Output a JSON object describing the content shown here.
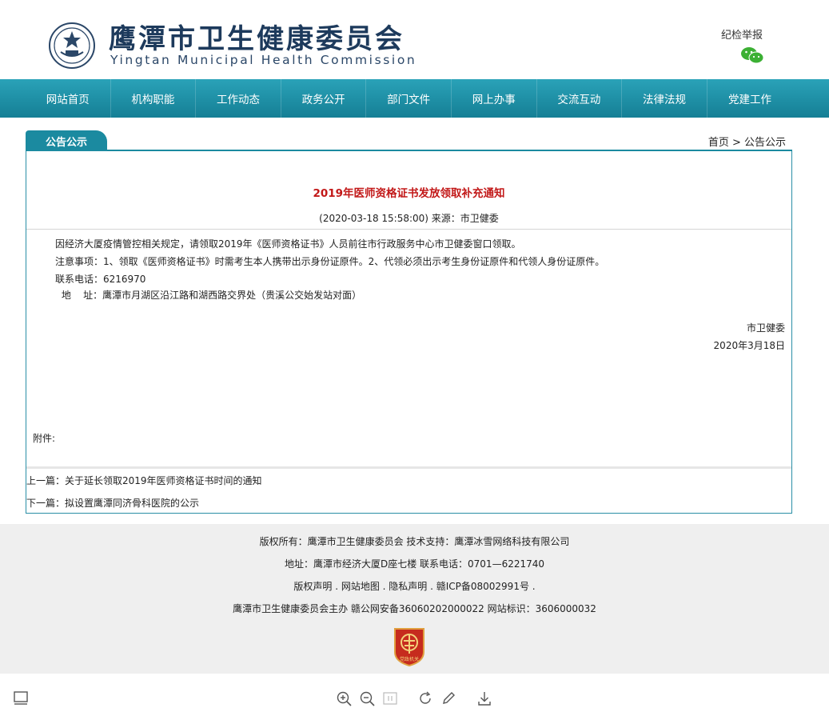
{
  "window": {
    "minimize": "–",
    "maximize": "☐",
    "close": "✕"
  },
  "header": {
    "title_cn": "鹰潭市卫生健康委员会",
    "title_en": "Yingtan Municipal Health Commission",
    "report_link": "纪检举报",
    "wechat_icon": "wechat-icon"
  },
  "nav": {
    "items": [
      "网站首页",
      "机构职能",
      "工作动态",
      "政务公开",
      "部门文件",
      "网上办事",
      "交流互动",
      "法律法规",
      "党建工作"
    ]
  },
  "section": {
    "tab": "公告公示",
    "breadcrumb": "首页 > 公告公示"
  },
  "article": {
    "title": "2019年医师资格证书发放领取补充通知",
    "meta": "(2020-03-18 15:58:00)   来源：市卫健委",
    "lines": [
      "因经济大厦疫情管控相关规定，请领取2019年《医师资格证书》人员前往市行政服务中心市卫健委窗口领取。",
      "注意事项：1、领取《医师资格证书》时需考生本人携带出示身份证原件。2、代领必须出示考生身份证原件和代领人身份证原件。",
      "联系电话：6216970",
      " 地    址：鹰潭市月湖区沿江路和湖西路交界处（贵溪公交始发站对面）"
    ],
    "sign_org": "市卫健委",
    "sign_date": "2020年3月18日",
    "attachment": "附件:",
    "prev": "上一篇：关于延长领取2019年医师资格证书时间的通知",
    "next": "下一篇：拟设置鹰潭同济骨科医院的公示"
  },
  "footer": {
    "line1": "版权所有：鹰潭市卫生健康委员会 技术支持：鹰潭冰雪网络科技有限公司",
    "line2": "地址：鹰潭市经济大厦D座七楼 联系电话：0701—6221740",
    "line3": "版权声明 . 网站地图 . 隐私声明 . 赣ICP备08002991号 .",
    "line4": "鹰潭市卫生健康委员会主办 赣公网安备36060202000022 网站标识：3606000032",
    "badge_text": "党政机关"
  },
  "colors": {
    "nav_top": "#2aa2b8",
    "nav_bottom": "#157f95",
    "accent": "#1b8aa0",
    "title_red": "#c21818",
    "footer_bg": "#efefef"
  }
}
